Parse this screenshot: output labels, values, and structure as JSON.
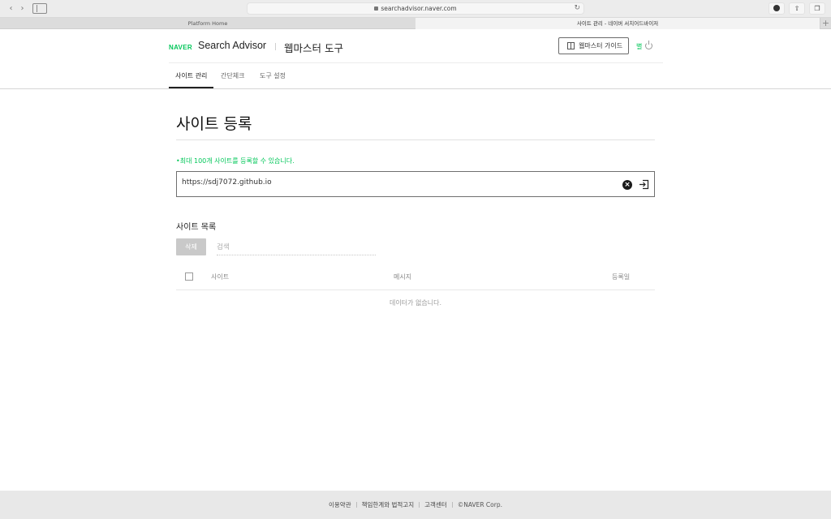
{
  "browser": {
    "url": "searchadvisor.naver.com",
    "tabs": [
      {
        "label": "Platform Home"
      },
      {
        "label": "사이트 관리 - 네이버 서치어드바이저"
      }
    ]
  },
  "header": {
    "naver_logo": "NAVER",
    "product_name": "Search Advisor",
    "section_name": "웹마스터 도구",
    "guide_button": "웹마스터 가이드",
    "user_name": "별"
  },
  "nav": {
    "tabs": [
      {
        "label": "사이트 관리",
        "active": true
      },
      {
        "label": "간단체크",
        "active": false
      },
      {
        "label": "도구 설정",
        "active": false
      }
    ]
  },
  "main": {
    "page_title": "사이트 등록",
    "notice": "•최대 100개 사이트를 등록할 수 있습니다.",
    "url_input_value": "https://sdj7072.github.io",
    "list_title": "사이트 목록",
    "delete_button": "삭제",
    "search_placeholder": "검색",
    "table": {
      "columns": [
        "사이트",
        "메시지",
        "등록일"
      ],
      "empty_message": "데이터가 없습니다."
    }
  },
  "footer": {
    "links": [
      "이용약관",
      "책임한계와 법적고지",
      "고객센터",
      "©NAVER Corp."
    ]
  },
  "colors": {
    "brand_green": "#03c75a"
  }
}
